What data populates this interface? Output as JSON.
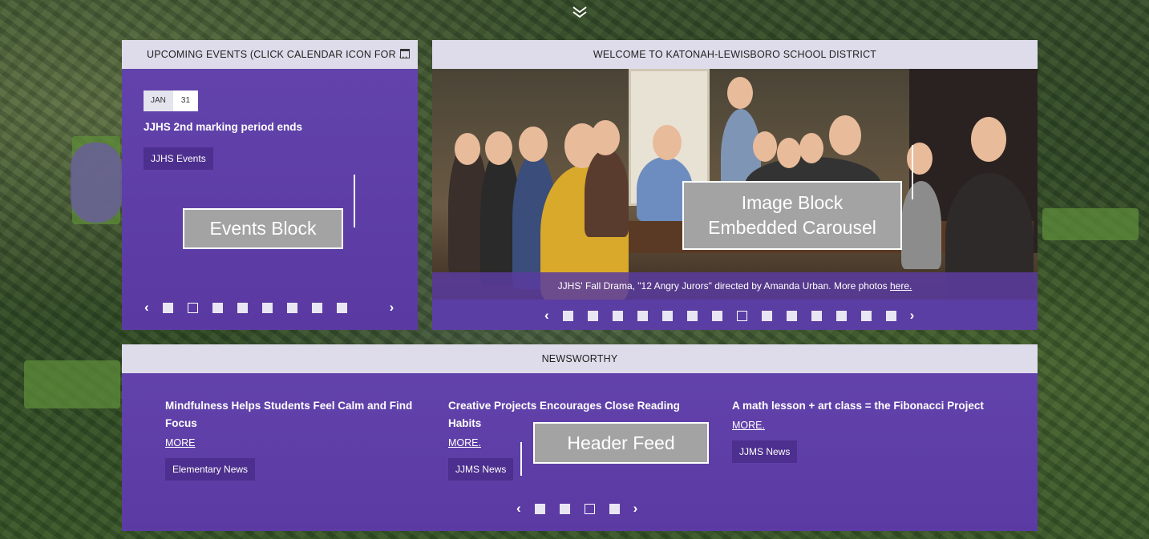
{
  "events": {
    "header": "UPCOMING EVENTS (CLICK CALENDAR ICON FOR ...",
    "month": "JAN",
    "day": "31",
    "title": "JJHS 2nd marking period ends",
    "tag": "JJHS Events",
    "callout": "Events Block",
    "slide_count": 8,
    "active_slide": 2
  },
  "welcome": {
    "header": "WELCOME TO KATONAH-LEWISBORO SCHOOL DISTRICT",
    "caption_prefix": "JJHS' Fall Drama, \"12 Angry Jurors\" directed by Amanda Urban. More photos ",
    "caption_link": "here.",
    "callout_line1": "Image Block",
    "callout_line2": "Embedded Carousel",
    "slide_count": 14,
    "active_slide": 8
  },
  "news": {
    "header": "NEWSWORTHY",
    "callout": "Header Feed",
    "items": [
      {
        "title": "Mindfulness Helps Students Feel Calm and Find Focus",
        "more": "MORE",
        "tag": "Elementary News"
      },
      {
        "title": "Creative Projects Encourages Close Reading Habits",
        "more": "MORE.",
        "tag": "JJMS News"
      },
      {
        "title": "A math lesson + art class = the Fibonacci Project",
        "more": "MORE.",
        "tag": "JJMS News"
      }
    ],
    "slide_count": 4,
    "active_slide": 3
  },
  "icons": {
    "top": "double-chevron-down-icon",
    "calendar": "calendar-icon",
    "prev": "chevron-left-icon",
    "next": "chevron-right-icon"
  }
}
